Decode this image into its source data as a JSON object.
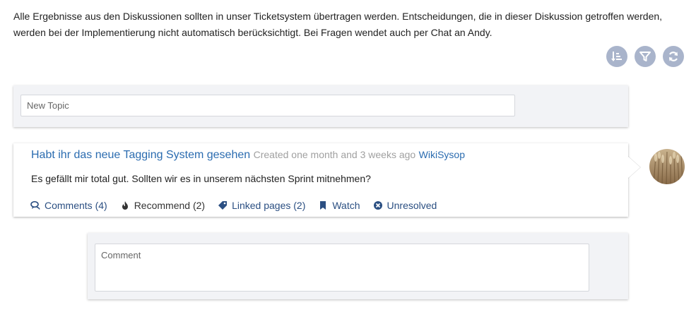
{
  "intro_text": "Alle Ergebnisse aus den Diskussionen sollten in unser Ticketsystem übertragen werden. Entscheidungen, die in dieser Diskussion getroffen werden, werden bei der Implementierung nicht automatisch berücksichtigt. Bei Fragen wendet auch per Chat an Andy.",
  "toolbar": {
    "icons": [
      "sort-icon",
      "filter-icon",
      "refresh-icon"
    ],
    "button_color": "#a9b4cb"
  },
  "new_topic": {
    "placeholder": "New Topic"
  },
  "topic": {
    "title": "Habt ihr das neue Tagging System gesehen",
    "meta": "Created one month and 3 weeks ago",
    "author": "WikiSysop",
    "body": "Es gefällt mir total gut. Sollten wir es in unserem nächsten Sprint mitnehmen?",
    "actions": {
      "comments": "Comments (4)",
      "recommend": "Recommend (2)",
      "linked_pages": "Linked pages (2)",
      "watch": "Watch",
      "unresolved": "Unresolved"
    },
    "avatar_icon": "user-avatar-wheat"
  },
  "comment": {
    "placeholder": "Comment"
  },
  "colors": {
    "link": "#2b6cb0",
    "action": "#2b4f82",
    "panel_bg": "#f2f3f6"
  }
}
